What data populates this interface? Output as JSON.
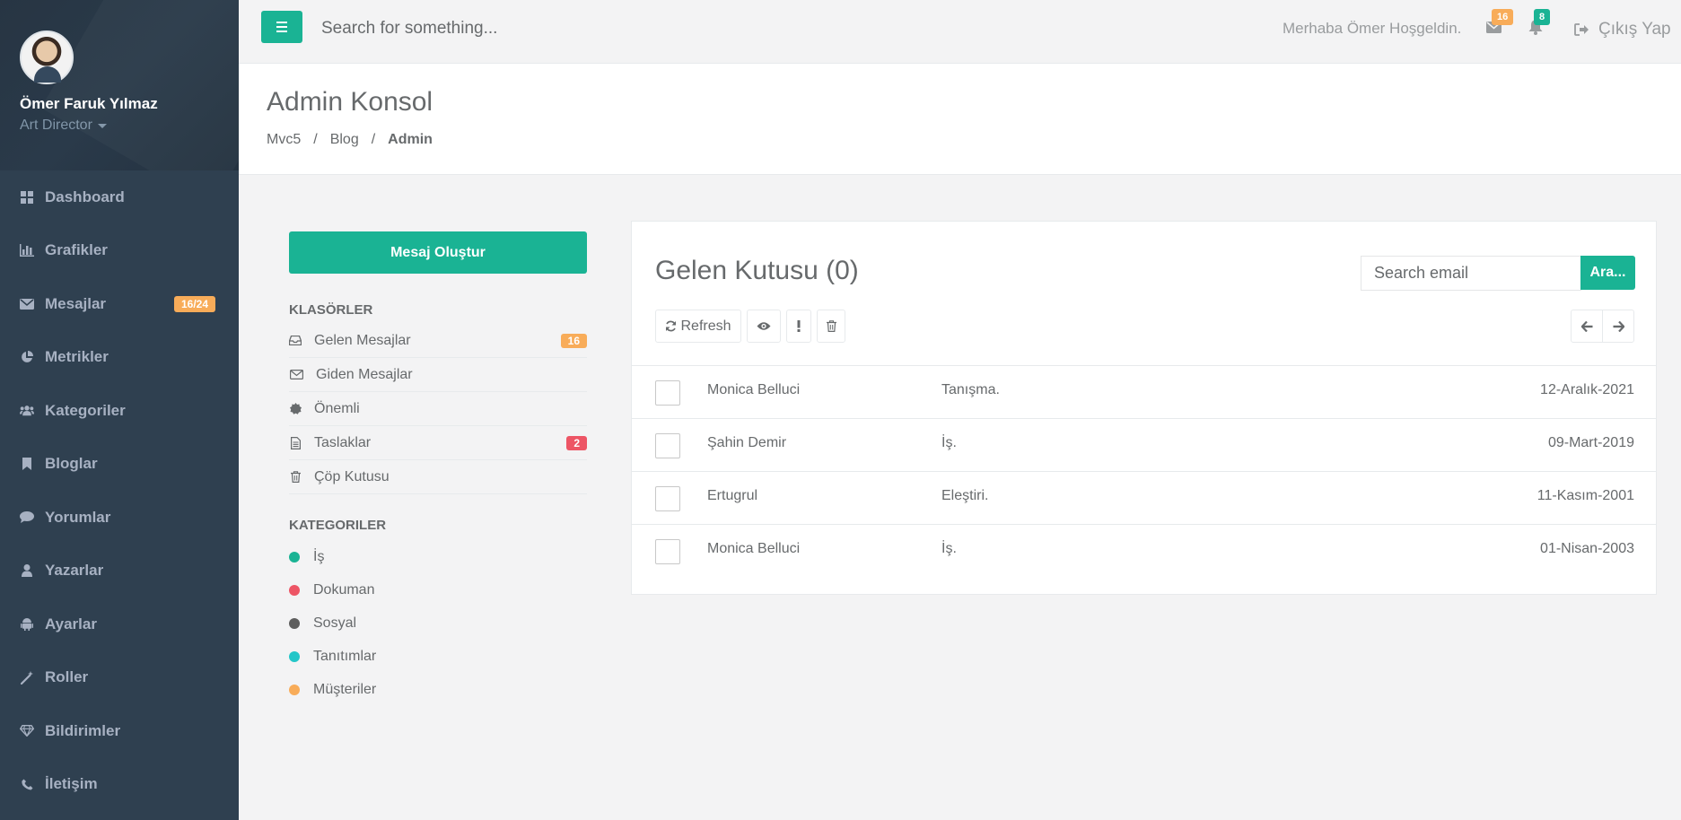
{
  "profile": {
    "name": "Ömer Faruk Yılmaz",
    "role": "Art Director"
  },
  "nav": [
    {
      "label": "Dashboard",
      "icon": "dashboard-icon"
    },
    {
      "label": "Grafikler",
      "icon": "bar-chart-icon"
    },
    {
      "label": "Mesajlar",
      "icon": "envelope-icon",
      "badge": "16/24"
    },
    {
      "label": "Metrikler",
      "icon": "pie-chart-icon"
    },
    {
      "label": "Kategoriler",
      "icon": "users-icon"
    },
    {
      "label": "Bloglar",
      "icon": "bookmark-icon"
    },
    {
      "label": "Yorumlar",
      "icon": "comment-icon"
    },
    {
      "label": "Yazarlar",
      "icon": "user-icon"
    },
    {
      "label": "Ayarlar",
      "icon": "android-icon"
    },
    {
      "label": "Roller",
      "icon": "magic-wand-icon"
    },
    {
      "label": "Bildirimler",
      "icon": "diamond-icon"
    },
    {
      "label": "İletişim",
      "icon": "phone-icon"
    }
  ],
  "topbar": {
    "search_placeholder": "Search for something...",
    "welcome": "Merhaba Ömer Hoşgeldin.",
    "mail_badge": "16",
    "bell_badge": "8",
    "logout": "Çıkış Yap"
  },
  "heading": {
    "title": "Admin Konsol",
    "breadcrumb": [
      "Mvc5",
      "Blog",
      "Admin"
    ]
  },
  "mailbox": {
    "compose": "Mesaj Oluştur",
    "folders_title": "KLASÖRLER",
    "folders": [
      {
        "label": "Gelen Mesajlar",
        "icon": "inbox-icon",
        "badge": "16"
      },
      {
        "label": "Giden Mesajlar",
        "icon": "envelope-outline-icon"
      },
      {
        "label": "Önemli",
        "icon": "certificate-icon"
      },
      {
        "label": "Taslaklar",
        "icon": "file-text-icon",
        "badge": "2"
      },
      {
        "label": "Çöp Kutusu",
        "icon": "trash-icon"
      }
    ],
    "categories_title": "KATEGORILER",
    "categories": [
      {
        "label": "İş",
        "color": "#1ab394"
      },
      {
        "label": "Dokuman",
        "color": "#ed5565"
      },
      {
        "label": "Sosyal",
        "color": "#5e5e5e"
      },
      {
        "label": "Tanıtımlar",
        "color": "#23c6c8"
      },
      {
        "label": "Müşteriler",
        "color": "#f8ac59"
      }
    ]
  },
  "inbox": {
    "title": "Gelen Kutusu (0)",
    "search_placeholder": "Search email",
    "search_button": "Ara...",
    "refresh": "Refresh",
    "rows": [
      {
        "sender": "Monica Belluci",
        "subject": "Tanışma.",
        "date": "12-Aralık-2021"
      },
      {
        "sender": "Şahin Demir",
        "subject": "İş.",
        "date": "09-Mart-2019"
      },
      {
        "sender": "Ertugrul",
        "subject": "Eleştiri.",
        "date": "11-Kasım-2001"
      },
      {
        "sender": "Monica Belluci",
        "subject": "İş.",
        "date": "01-Nisan-2003"
      }
    ]
  },
  "colors": {
    "accent": "#1ab394",
    "sidebar": "#2f4050",
    "warning": "#f8ac59",
    "danger": "#ed5565"
  }
}
